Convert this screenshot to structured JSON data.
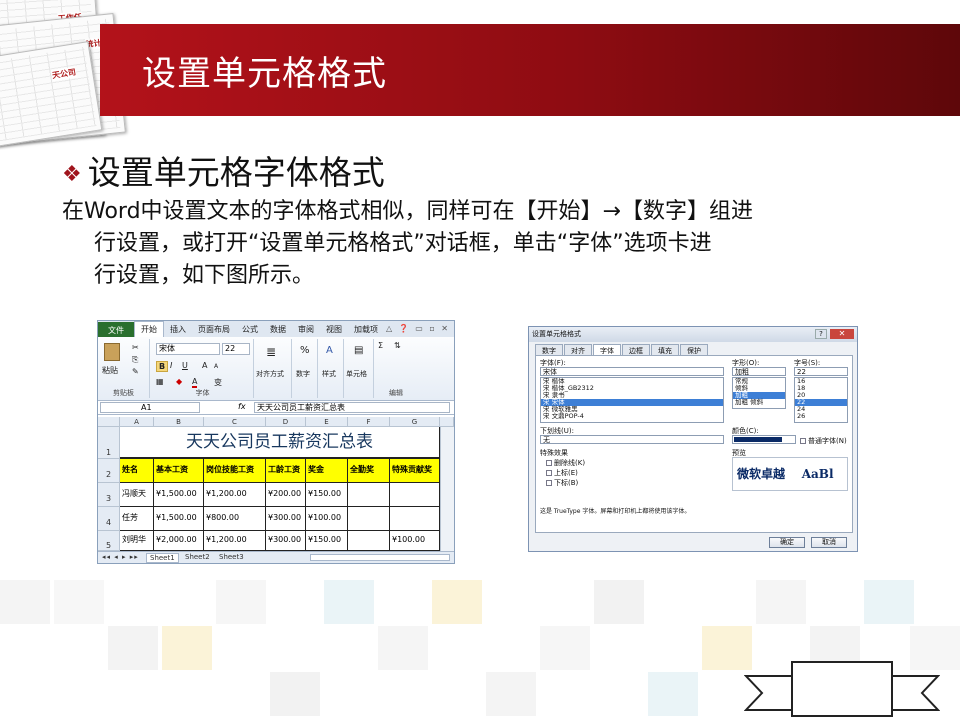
{
  "slide": {
    "title": "设置单元格格式",
    "heading_bullet": "❖",
    "heading": "设置单元格字体格式",
    "para_lines": [
      "在Word中设置文本的字体格式相似，同样可在【开始】→【数字】组进",
      "行设置，或打开“设置单元格格式”对话框，单击“字体”选项卡进",
      "行设置，如下图所示。"
    ],
    "corner_sheet_labels": [
      "工作任",
      "统计表",
      "天公司"
    ]
  },
  "excel": {
    "tabs": [
      "文件",
      "开始",
      "插入",
      "页面布局",
      "公式",
      "数据",
      "审阅",
      "视图",
      "加载项"
    ],
    "active_tab": "开始",
    "window_controls": "△ ❓ ▭ ▫ ✕",
    "font_name": "宋体",
    "font_size": "22",
    "clipboard": {
      "paste": "粘贴",
      "label": "剪贴板"
    },
    "font_group": {
      "bold": "B",
      "italic": "I",
      "underline": "U",
      "grow": "A",
      "shrink": "A",
      "color": "A",
      "wen": "变",
      "label": "字体"
    },
    "align_label": "对齐方式",
    "number_label": "数字",
    "style_label": "样式",
    "cells_label": "单元格",
    "edit_label": "编辑",
    "sum_symbol": "Σ",
    "name_box": "A1",
    "fx": "fx",
    "formula": "天天公司员工薪资汇总表",
    "columns": [
      "A",
      "B",
      "C",
      "D",
      "E",
      "F",
      "G"
    ],
    "row_numbers": [
      "1",
      "2",
      "3",
      "4",
      "5"
    ],
    "table_title": "天天公司员工薪资汇总表",
    "headers": [
      "姓名",
      "基本工资",
      "岗位技能工资",
      "工龄工资",
      "奖金",
      "全勤奖",
      "特殊贡献奖"
    ],
    "rows": [
      [
        "冯顺天",
        "¥1,500.00",
        "¥1,200.00",
        "¥200.00",
        "¥150.00",
        "",
        ""
      ],
      [
        "任芳",
        "¥1,500.00",
        "¥800.00",
        "¥300.00",
        "¥100.00",
        "",
        ""
      ],
      [
        "刘明华",
        "¥2,000.00",
        "¥1,200.00",
        "¥300.00",
        "¥150.00",
        "",
        "¥100.00"
      ]
    ],
    "sheet_tabs": [
      "Sheet1",
      "Sheet2",
      "Sheet3"
    ]
  },
  "dialog": {
    "title": "设置单元格格式",
    "close": "✕",
    "help": "?",
    "tabs": [
      "数字",
      "对齐",
      "字体",
      "边框",
      "填充",
      "保护"
    ],
    "active_tab": "字体",
    "font_label": "字体(F):",
    "font_value": "宋体",
    "font_list": [
      "宋 楷体",
      "宋 楷体_GB2312",
      "宋 隶书",
      "宋 宋体",
      "宋 微软雅黑",
      "宋 文鼎POP-4"
    ],
    "font_selected": "宋 宋体",
    "style_label": "字形(O):",
    "style_value": "加粗",
    "style_list": [
      "常规",
      "倾斜",
      "加粗",
      "加粗 倾斜"
    ],
    "style_selected": "加粗",
    "size_label": "字号(S):",
    "size_value": "22",
    "size_list": [
      "16",
      "18",
      "20",
      "22",
      "24",
      "26"
    ],
    "size_selected": "22",
    "underline_label": "下划线(U):",
    "underline_value": "无",
    "color_label": "颜色(C):",
    "color_value": "#0a2a66",
    "normal_font": "普通字体(N)",
    "effects_label": "特殊效果",
    "effects": [
      "删除线(K)",
      "上标(E)",
      "下标(B)"
    ],
    "preview_label": "预览",
    "preview_text": "微软卓越    AaBl",
    "note": "这是 TrueType 字体。屏幕和打印机上都将使用该字体。",
    "ok": "确定",
    "cancel": "取消"
  },
  "colors": {
    "title_bar": "#a0141c",
    "excel_file_tab": "#2a6f2e",
    "header_fill": "#ffff00",
    "table_title_color": "#17375e"
  }
}
